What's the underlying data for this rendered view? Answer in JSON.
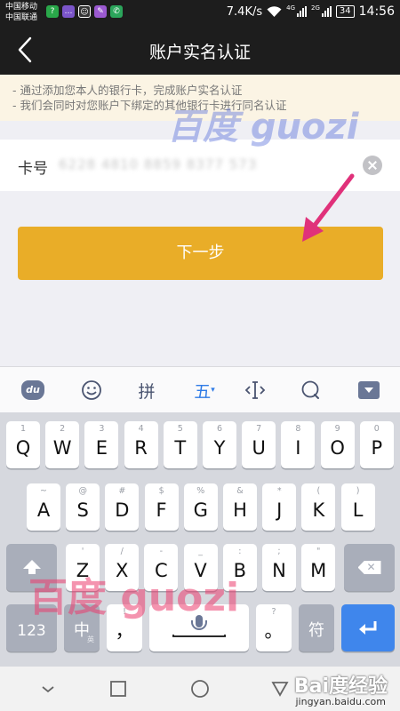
{
  "status_bar": {
    "carrier1": "中国移动",
    "carrier2": "中国联通",
    "speed": "7.4K/s",
    "net1": "4G",
    "net2": "2G",
    "battery": "34",
    "time": "14:56",
    "notif_icons": [
      "app-green",
      "messenger",
      "qq",
      "app-purple",
      "phone"
    ]
  },
  "header": {
    "title": "账户实名认证",
    "back_icon": "chevron-left-icon"
  },
  "notice": {
    "lines": [
      "- 通过添加您本人的银行卡，完成账户实名认证",
      "- 我们会同时对您账户下绑定的其他银行卡进行同名认证"
    ]
  },
  "form": {
    "card_label": "卡号",
    "card_value": "6228 4810 8859 8377 573",
    "clear_icon": "clear-circle-icon"
  },
  "next_button": "下一步",
  "watermarks": {
    "blue": "百度 guozi",
    "red": "百度 guozi"
  },
  "ime": {
    "du_label": "du",
    "emoji_icon": "smiley-icon",
    "pinyin_label": "拼",
    "wubi_label": "五",
    "cursor_icon": "cursor-move-icon",
    "search_icon": "search-icon",
    "hide_icon": "hide-keyboard-icon"
  },
  "keyboard": {
    "row1": [
      {
        "main": "Q",
        "hint": "1"
      },
      {
        "main": "W",
        "hint": "2"
      },
      {
        "main": "E",
        "hint": "3"
      },
      {
        "main": "R",
        "hint": "4"
      },
      {
        "main": "T",
        "hint": "5"
      },
      {
        "main": "Y",
        "hint": "6"
      },
      {
        "main": "U",
        "hint": "7"
      },
      {
        "main": "I",
        "hint": "8"
      },
      {
        "main": "O",
        "hint": "9"
      },
      {
        "main": "P",
        "hint": "0"
      }
    ],
    "row2": [
      {
        "main": "A",
        "hint": "~"
      },
      {
        "main": "S",
        "hint": "@"
      },
      {
        "main": "D",
        "hint": "#"
      },
      {
        "main": "F",
        "hint": "$"
      },
      {
        "main": "G",
        "hint": "%"
      },
      {
        "main": "H",
        "hint": "&"
      },
      {
        "main": "J",
        "hint": "*"
      },
      {
        "main": "K",
        "hint": "("
      },
      {
        "main": "L",
        "hint": ")"
      }
    ],
    "row3": [
      {
        "main": "Z",
        "hint": "'"
      },
      {
        "main": "X",
        "hint": "/"
      },
      {
        "main": "C",
        "hint": "-"
      },
      {
        "main": "V",
        "hint": "_"
      },
      {
        "main": "B",
        "hint": ":"
      },
      {
        "main": "N",
        "hint": ";"
      },
      {
        "main": "M",
        "hint": "\""
      }
    ],
    "shift_icon": "shift-icon",
    "backspace_icon": "backspace-icon",
    "num_label": "123",
    "lang_label": "中",
    "lang_sub": "英",
    "comma_label": "，",
    "comma_hint": "!",
    "mic_icon": "microphone-icon",
    "period_label": "。",
    "period_hint": "?",
    "symbol_label": "符",
    "enter_icon": "enter-icon"
  },
  "nav_bar": {
    "back_icon": "nav-back-icon",
    "home_icon": "nav-home-icon",
    "recent_icon": "nav-recent-icon"
  },
  "site_mark": {
    "logo": "Bai度经验",
    "url": "jingyan.baidu.com"
  }
}
